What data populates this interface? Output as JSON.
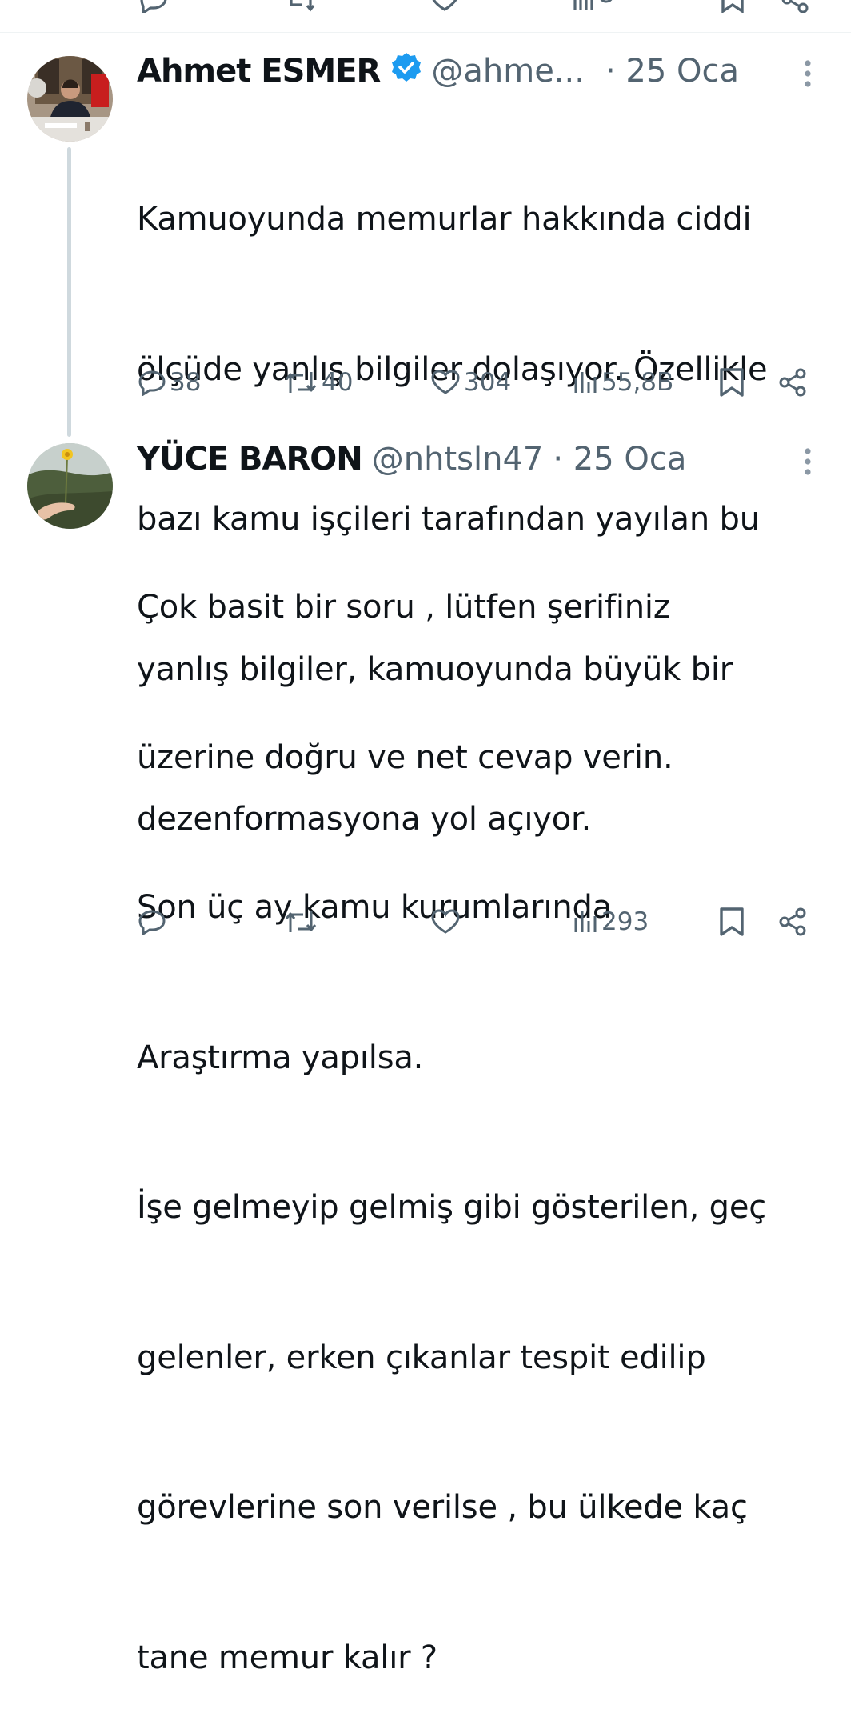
{
  "tweets": [
    {
      "author": "Ahmet ESMER",
      "handle": "@ahme...",
      "date": "· 25 Oca",
      "verified": true,
      "lines": [
        "Kamuoyunda memurlar hakkında ciddi",
        "ölçüde yanlış bilgiler dolaşıyor. Özellikle",
        "bazı kamu işçileri tarafından yayılan bu",
        "yanlış bilgiler, kamuoyunda büyük bir",
        "dezenformasyona yol açıyor."
      ],
      "replies": "38",
      "reposts": "40",
      "likes": "304",
      "views": "55,8B"
    },
    {
      "author": "YÜCE BARON",
      "handle": "@nhtsln47",
      "date": "· 25 Oca",
      "verified": false,
      "lines": [
        "Çok basit bir soru , lütfen şerifiniz",
        "üzerine doğru ve net cevap verin.",
        "Son üç ay kamu kurumlarında",
        "Araştırma yapılsa.",
        "İşe gelmeyip gelmiş gibi gösterilen, geç",
        "gelenler, erken çıkanlar tespit edilip",
        "görevlerine son verilse , bu ülkede kaç",
        "tane memur kalır ?"
      ],
      "views": "293"
    }
  ],
  "icons": {
    "reply": "reply-icon",
    "repost": "repost-icon",
    "like": "heart-icon",
    "views": "views-icon",
    "bookmark": "bookmark-icon",
    "share": "share-icon",
    "more": "more-icon",
    "verified": "verified-badge-icon"
  },
  "colors": {
    "text": "#0f1419",
    "muted": "#536471",
    "verified": "#1d9bf0",
    "thread_line": "#cfd9de",
    "divider": "#eff3f4"
  }
}
